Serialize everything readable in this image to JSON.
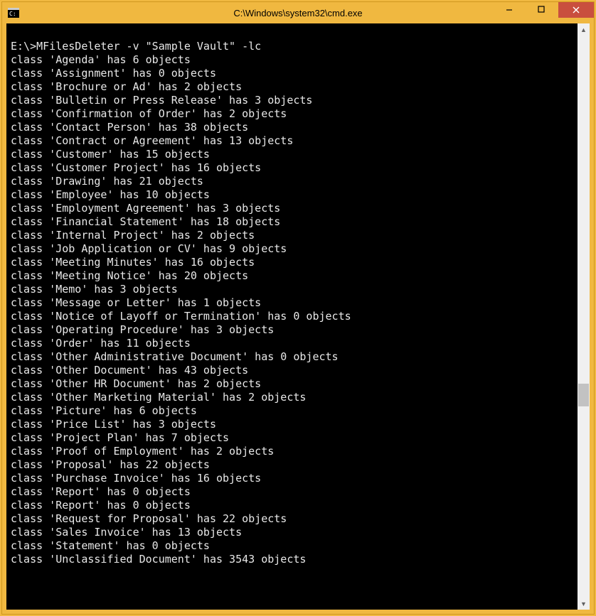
{
  "window": {
    "title": "C:\\Windows\\system32\\cmd.exe"
  },
  "console": {
    "prompt": "E:\\>",
    "command": "MFilesDeleter -v \"Sample Vault\" -lc",
    "classes": [
      {
        "name": "Agenda",
        "count": 6
      },
      {
        "name": "Assignment",
        "count": 0
      },
      {
        "name": "Brochure or Ad",
        "count": 2
      },
      {
        "name": "Bulletin or Press Release",
        "count": 3
      },
      {
        "name": "Confirmation of Order",
        "count": 2
      },
      {
        "name": "Contact Person",
        "count": 38
      },
      {
        "name": "Contract or Agreement",
        "count": 13
      },
      {
        "name": "Customer",
        "count": 15
      },
      {
        "name": "Customer Project",
        "count": 16
      },
      {
        "name": "Drawing",
        "count": 21
      },
      {
        "name": "Employee",
        "count": 10
      },
      {
        "name": "Employment Agreement",
        "count": 3
      },
      {
        "name": "Financial Statement",
        "count": 18
      },
      {
        "name": "Internal Project",
        "count": 2
      },
      {
        "name": "Job Application or CV",
        "count": 9
      },
      {
        "name": "Meeting Minutes",
        "count": 16
      },
      {
        "name": "Meeting Notice",
        "count": 20
      },
      {
        "name": "Memo",
        "count": 3
      },
      {
        "name": "Message or Letter",
        "count": 1
      },
      {
        "name": "Notice of Layoff or Termination",
        "count": 0
      },
      {
        "name": "Operating Procedure",
        "count": 3
      },
      {
        "name": "Order",
        "count": 11
      },
      {
        "name": "Other Administrative Document",
        "count": 0
      },
      {
        "name": "Other Document",
        "count": 43
      },
      {
        "name": "Other HR Document",
        "count": 2
      },
      {
        "name": "Other Marketing Material",
        "count": 2
      },
      {
        "name": "Picture",
        "count": 6
      },
      {
        "name": "Price List",
        "count": 3
      },
      {
        "name": "Project Plan",
        "count": 7
      },
      {
        "name": "Proof of Employment",
        "count": 2
      },
      {
        "name": "Proposal",
        "count": 22
      },
      {
        "name": "Purchase Invoice",
        "count": 16
      },
      {
        "name": "Report",
        "count": 0
      },
      {
        "name": "Report",
        "count": 0
      },
      {
        "name": "Request for Proposal",
        "count": 22
      },
      {
        "name": "Sales Invoice",
        "count": 13
      },
      {
        "name": "Statement",
        "count": 0
      },
      {
        "name": "Unclassified Document",
        "count": 3543
      }
    ]
  }
}
